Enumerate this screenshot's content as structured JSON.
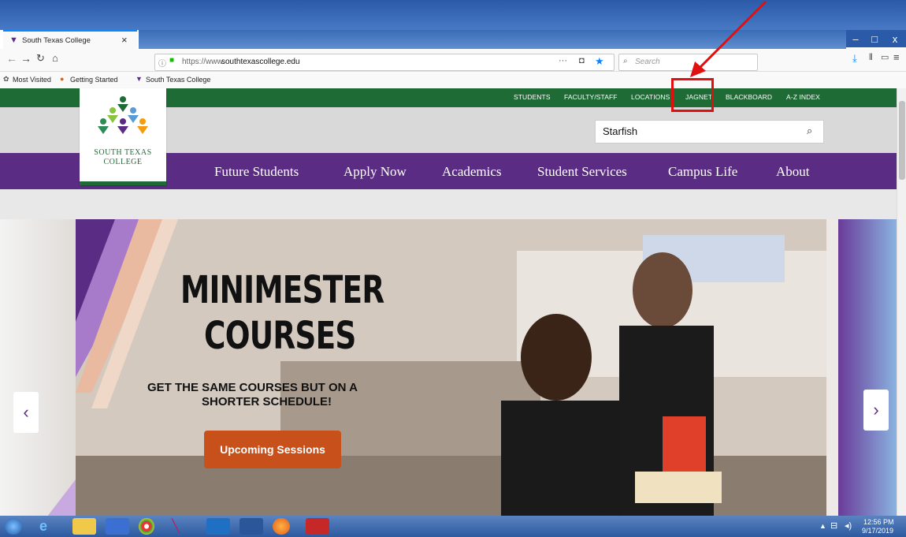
{
  "browser": {
    "tab_title": "South Texas College",
    "tab_close": "×",
    "url_prefix": "https://www.",
    "url_domain": "southtexascollege.edu",
    "search_placeholder": "Search",
    "bookmarks": [
      {
        "label": "Most Visited",
        "icon": "gear-icon"
      },
      {
        "label": "Getting Started",
        "icon": "firefox-icon"
      },
      {
        "label": "South Texas College",
        "icon": "stc-icon"
      }
    ],
    "window_controls": [
      "–",
      "□",
      "x"
    ],
    "nav_icons": [
      "back-icon",
      "forward-icon",
      "reload-icon",
      "home-icon"
    ],
    "toolbar_icons": [
      "download-icon",
      "library-icon",
      "sidebar-icon",
      "menu-icon"
    ],
    "more_glyph": "···"
  },
  "site": {
    "utility_links": [
      "STUDENTS",
      "FACULTY/STAFF",
      "LOCATIONS",
      "JAGNET",
      "BLACKBOARD",
      "A-Z INDEX"
    ],
    "logo_line1": "SOUTH TEXAS",
    "logo_line2": "COLLEGE",
    "search_value": "Starfish",
    "nav": [
      "Future Students",
      "Apply Now",
      "Academics",
      "Student Services",
      "Campus Life",
      "About"
    ]
  },
  "hero": {
    "headline_line1": "MINIMESTER",
    "headline_line2": "COURSES",
    "subline1": "GET THE SAME COURSES BUT ON A",
    "subline2": "SHORTER SCHEDULE!",
    "cta": "Upcoming Sessions",
    "prev": "‹",
    "next": "›"
  },
  "taskbar": {
    "time": "12:56 PM",
    "date": "9/17/2019"
  },
  "colors": {
    "utility_green": "#1f6b36",
    "nav_purple": "#5b2c83",
    "cta_orange": "#c8501a",
    "annotation_red": "#e01010"
  }
}
